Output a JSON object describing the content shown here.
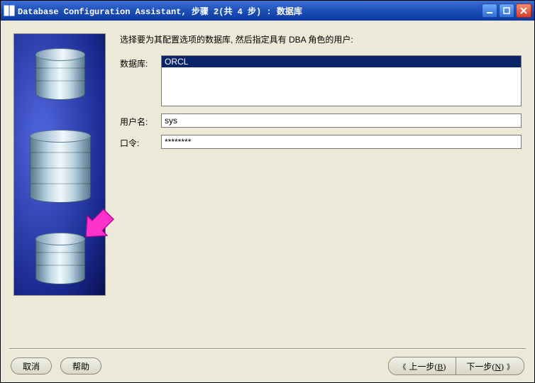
{
  "window": {
    "title": "Database Configuration Assistant, 步骤 2(共 4 步) : 数据库"
  },
  "content": {
    "instruction": "选择要为其配置选项的数据库, 然后指定具有 DBA 角色的用户:",
    "labels": {
      "database": "数据库:",
      "username": "用户名:",
      "password": "口令:"
    },
    "database_list": {
      "items": [
        "ORCL"
      ],
      "selected": "ORCL"
    },
    "fields": {
      "username": "sys",
      "password": "********"
    }
  },
  "buttons": {
    "cancel": "取消",
    "help": "帮助",
    "back_prefix": "上一步(",
    "back_key": "B",
    "back_suffix": ")",
    "next_prefix": "下一步(",
    "next_key": "N",
    "next_suffix": ")"
  }
}
